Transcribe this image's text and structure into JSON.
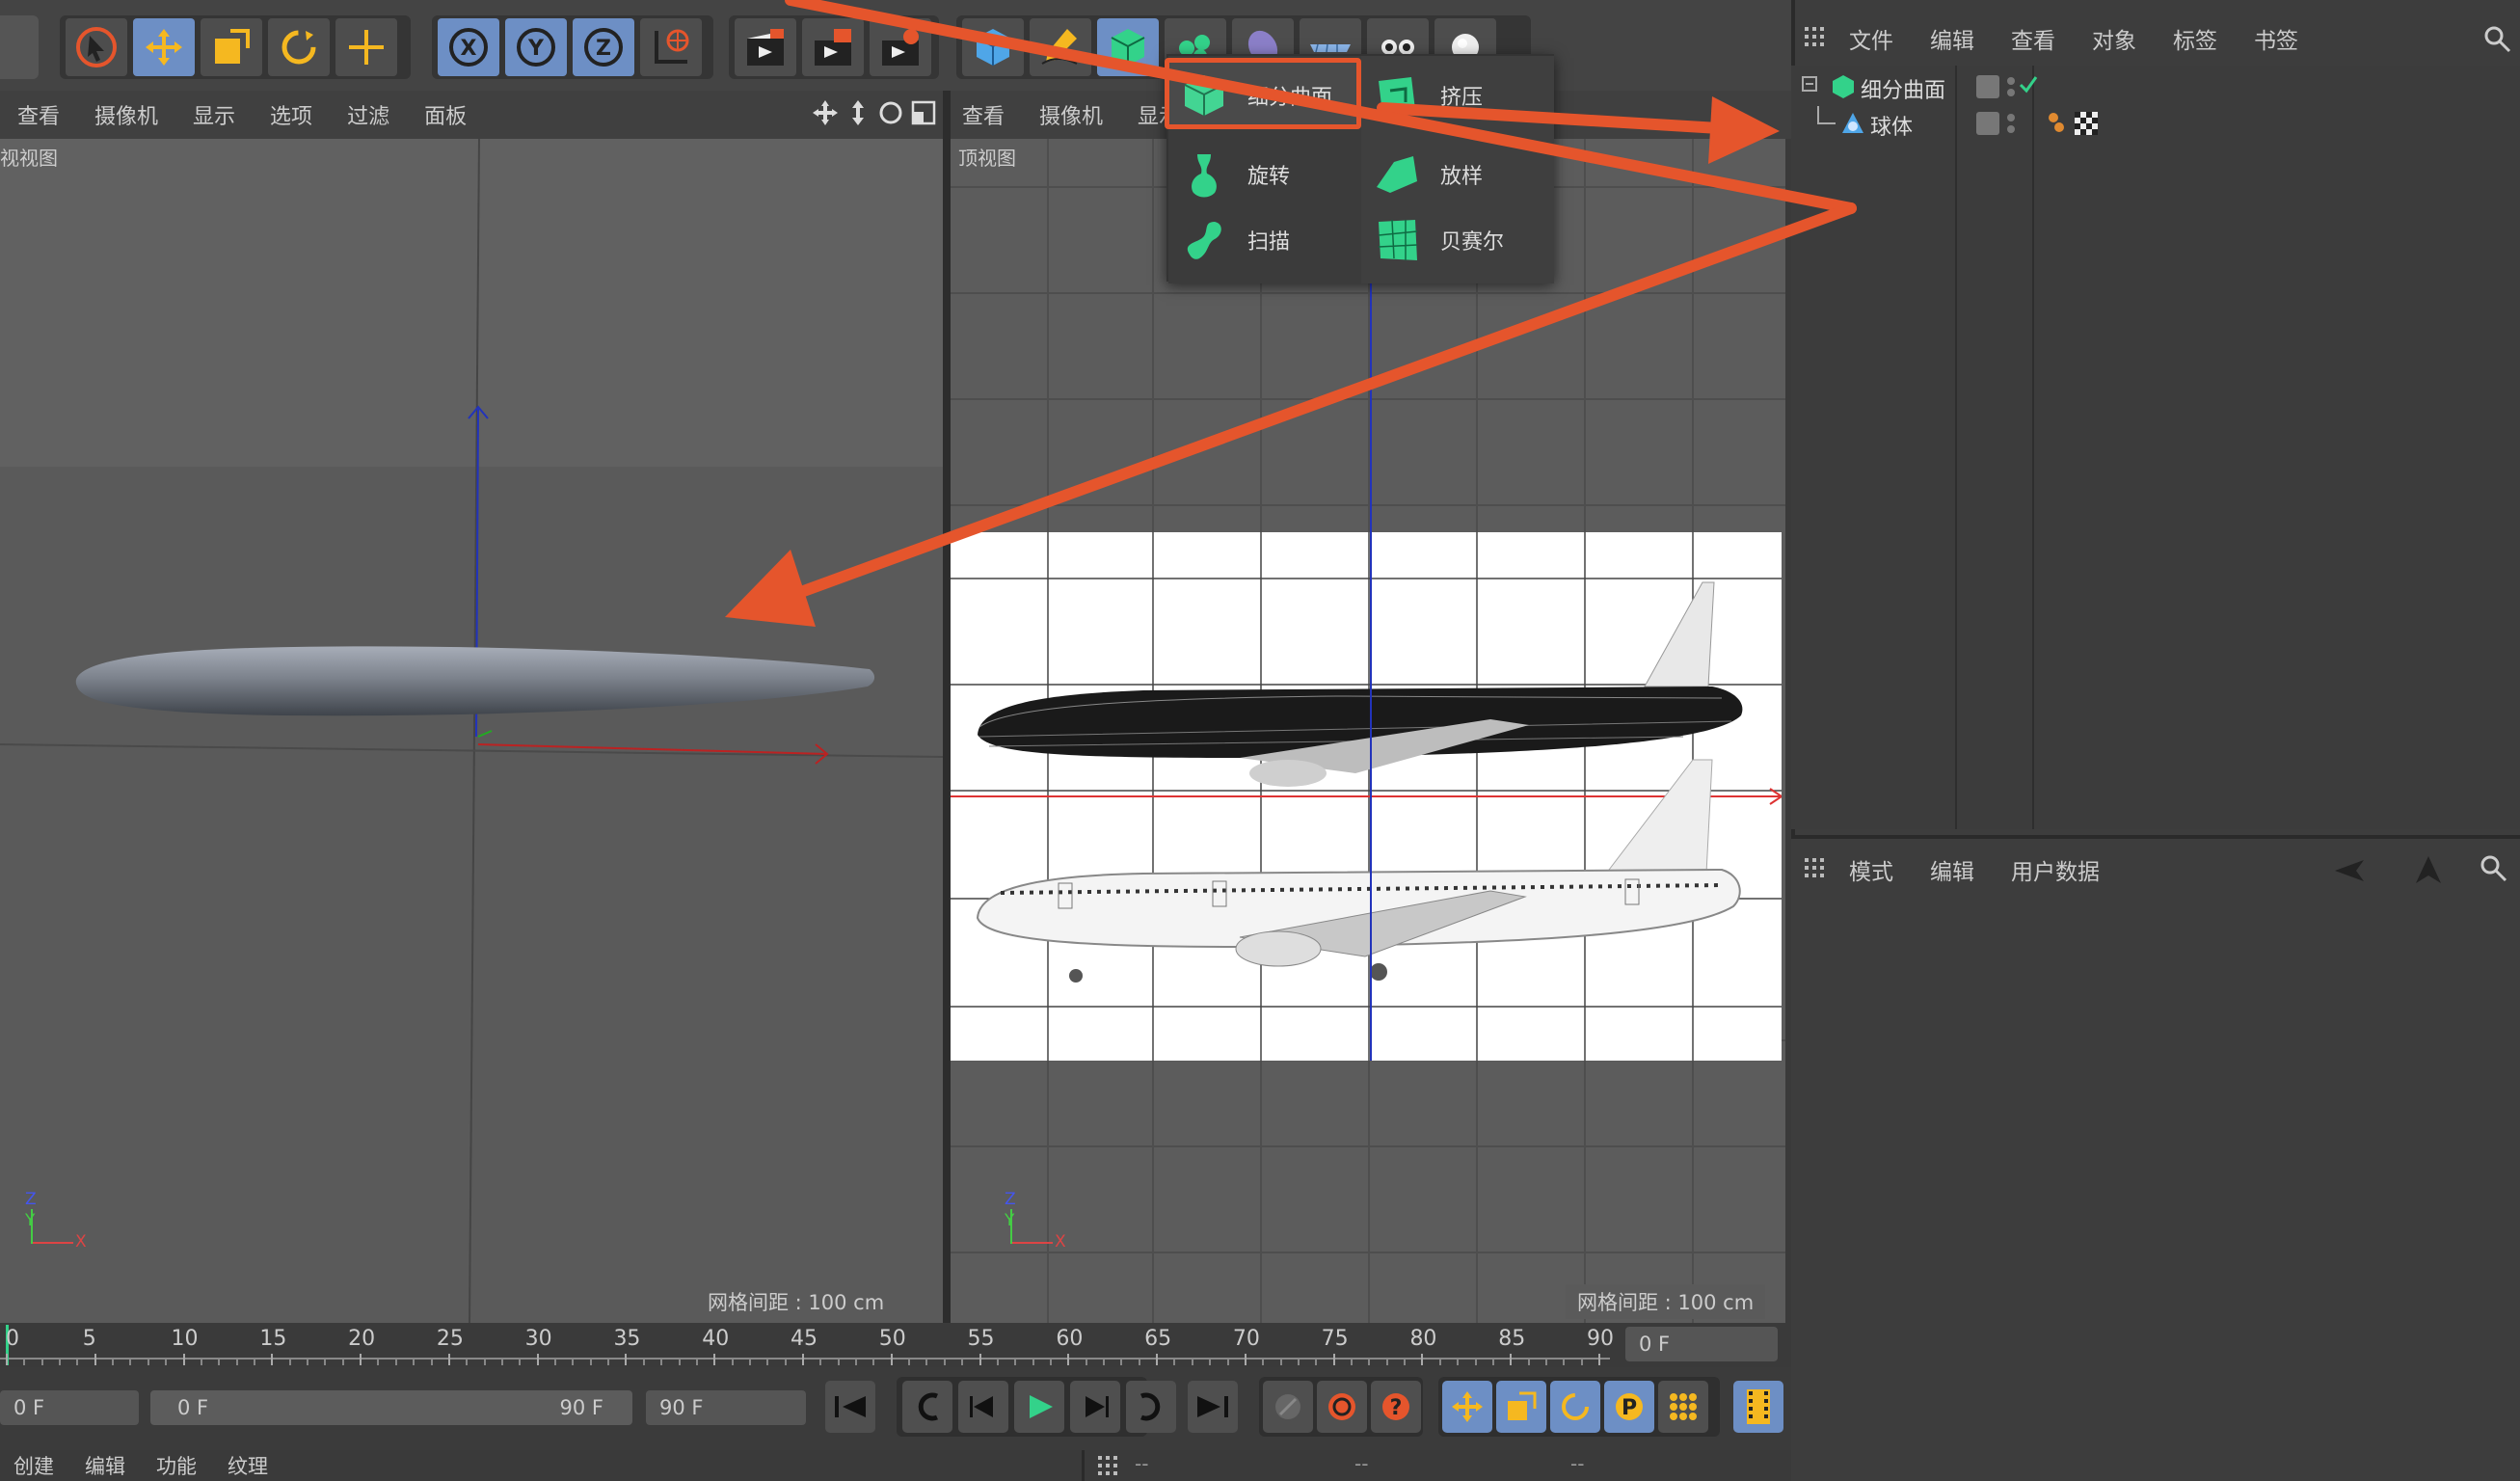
{
  "colors": {
    "accent_blue": "#6d8fc5",
    "highlight_orange": "#e5552c",
    "green_icon": "#33d28a",
    "viewport_bg": "#5d5d5d"
  },
  "toolbar": {
    "groups": [
      [
        "select-icon",
        "move-icon",
        "scale-icon",
        "rotate-icon",
        "plus-move-icon"
      ],
      [
        "x-axis-icon",
        "y-axis-icon",
        "z-axis-icon",
        "world-coords-icon"
      ],
      [
        "render-view-icon",
        "render-picture-icon",
        "render-settings-icon"
      ],
      [
        "cube-icon",
        "pen-icon",
        "subdivision-icon",
        "generator-icon",
        "deformer-icon",
        "floor-icon",
        "camera-icon",
        "light-icon"
      ]
    ]
  },
  "left_viewport": {
    "menu": [
      "查看",
      "摄像机",
      "显示",
      "选项",
      "过滤",
      "面板"
    ],
    "label": "视视图",
    "grid_info": "网格间距 : 100 cm",
    "axis_z": "Z",
    "axis_y": "Y",
    "axis_x": "X"
  },
  "right_viewport": {
    "menu": [
      "查看",
      "摄像机",
      "显示"
    ],
    "label": "顶视图",
    "grid_info": "网格间距 : 100 cm",
    "axis_z": "Z",
    "axis_y": "Y",
    "axis_x": "X"
  },
  "popup": {
    "items": [
      {
        "label": "细分曲面",
        "icon": "subdivision-surface-icon",
        "selected": true
      },
      {
        "label": "挤压",
        "icon": "extrude-icon"
      },
      {
        "label": "旋转",
        "icon": "lathe-icon"
      },
      {
        "label": "放样",
        "icon": "loft-icon"
      },
      {
        "label": "扫描",
        "icon": "sweep-icon"
      },
      {
        "label": "贝赛尔",
        "icon": "bezier-icon"
      }
    ]
  },
  "object_manager": {
    "menu": [
      "文件",
      "编辑",
      "查看",
      "对象",
      "标签",
      "书签"
    ],
    "objects": [
      {
        "name": "细分曲面",
        "icon": "subdivision-surface-icon"
      },
      {
        "name": "球体",
        "icon": "sphere-icon"
      }
    ]
  },
  "attribute_manager": {
    "menu": [
      "模式",
      "编辑",
      "用户数据"
    ]
  },
  "timeline": {
    "ticks": [
      "0",
      "5",
      "10",
      "15",
      "20",
      "25",
      "30",
      "35",
      "40",
      "45",
      "50",
      "55",
      "60",
      "65",
      "70",
      "75",
      "80",
      "85",
      "90"
    ],
    "current_frame": "0 F"
  },
  "transport": {
    "start_field": "0 F",
    "range_start": "0 F",
    "range_end": "90 F",
    "end_field": "90 F"
  },
  "bottom_menu": [
    "创建",
    "编辑",
    "功能",
    "纹理"
  ],
  "status_bar": [
    "--",
    "--",
    "--"
  ]
}
